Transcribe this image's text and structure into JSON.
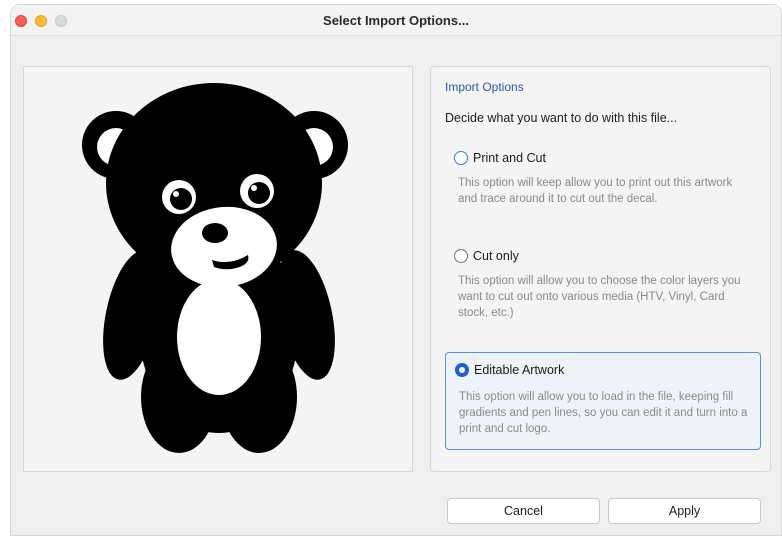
{
  "window": {
    "title": "Select Import Options..."
  },
  "import_options": {
    "section_title": "Import Options",
    "question": "Decide what you want to do with this file...",
    "options": [
      {
        "label": "Print and Cut",
        "description": "This option will keep allow you to print out this artwork and trace around it to cut out the decal.",
        "selected": false
      },
      {
        "label": "Cut only",
        "description": "This option will allow you to choose the color layers you want to cut out onto various media (HTV, Vinyl, Card stock, etc.)",
        "selected": false
      },
      {
        "label": "Editable Artwork",
        "description": "This option will allow you to load in the file, keeping fill gradients and pen lines, so you can edit it and turn into a print and cut logo.",
        "selected": true
      }
    ]
  },
  "buttons": {
    "cancel_label": "Cancel",
    "apply_label": "Apply"
  },
  "colors": {
    "accent": "#1f5fd0",
    "section_title": "#2b5aa8",
    "close": "#ff5f57",
    "minimize": "#febc2e",
    "maximize": "#d9d9d9"
  },
  "preview": {
    "image": "teddy-bear-silhouette"
  }
}
